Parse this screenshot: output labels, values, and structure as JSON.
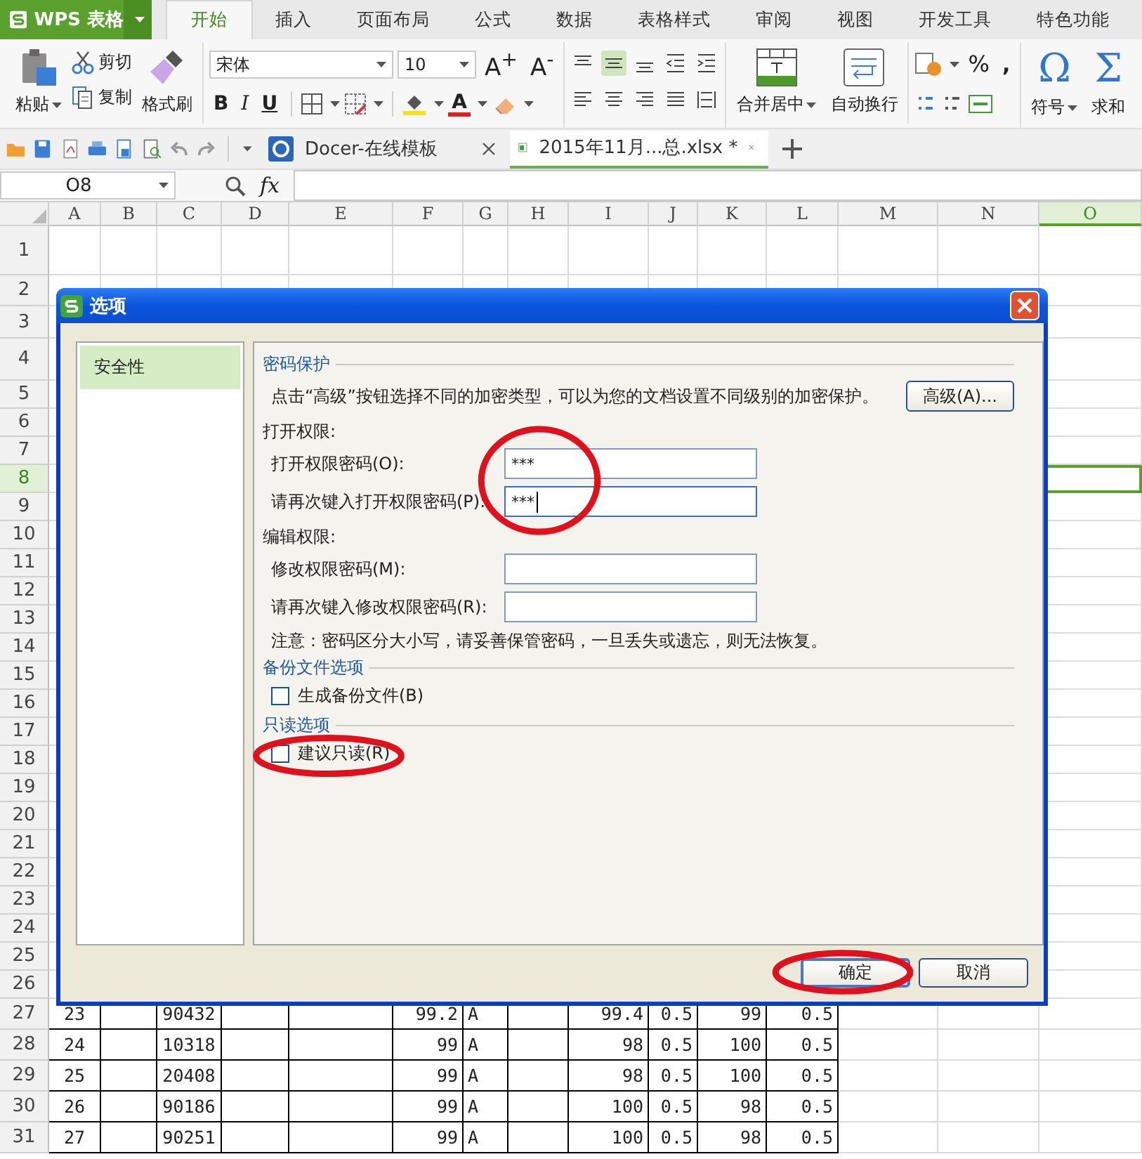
{
  "app_menu": {
    "label": "WPS 表格"
  },
  "ribbon_tabs": [
    {
      "label": "开始",
      "selected": true
    },
    {
      "label": "插入",
      "selected": false
    },
    {
      "label": "页面布局",
      "selected": false
    },
    {
      "label": "公式",
      "selected": false
    },
    {
      "label": "数据",
      "selected": false
    },
    {
      "label": "表格样式",
      "selected": false
    },
    {
      "label": "审阅",
      "selected": false
    },
    {
      "label": "视图",
      "selected": false
    },
    {
      "label": "开发工具",
      "selected": false
    },
    {
      "label": "特色功能",
      "selected": false
    }
  ],
  "ribbon": {
    "clipboard": {
      "paste": "粘贴",
      "cut": "剪切",
      "copy": "复制",
      "format_painter": "格式刷"
    },
    "font": {
      "name": "宋体",
      "size": "10",
      "grow": "A$^{+}$",
      "shrink": "A$^{-}$",
      "bold": "B",
      "italic": "I",
      "underline": "U",
      "font_color": "A"
    },
    "alignment": [
      {
        "kind": "top",
        "selected": false
      },
      {
        "kind": "middle",
        "selected": true
      },
      {
        "kind": "bottom",
        "selected": false
      },
      {
        "kind": "outdent",
        "selected": false
      },
      {
        "kind": "indent",
        "selected": false
      },
      {
        "kind": "left",
        "selected": false
      },
      {
        "kind": "center",
        "selected": false
      },
      {
        "kind": "right",
        "selected": false
      },
      {
        "kind": "justify",
        "selected": false
      },
      {
        "kind": "distributed",
        "selected": false
      }
    ],
    "merge": "合并居中",
    "wrap": "自动换行",
    "number": {
      "percent": "%",
      "comma": ","
    },
    "symbol": {
      "glyph": "Ω",
      "label": "符号"
    },
    "sum": {
      "glyph": "Σ",
      "label": "求和"
    }
  },
  "doc_tabs": [
    {
      "kind": "docer",
      "label": "Docer-在线模板",
      "selected": false
    },
    {
      "kind": "sheet",
      "label": "2015年11月...总.xlsx *",
      "selected": true
    }
  ],
  "formula_bar": {
    "cell": "O8",
    "fx": "fx"
  },
  "sheet": {
    "columns": [
      {
        "label": "A",
        "selected": false
      },
      {
        "label": "B",
        "selected": false
      },
      {
        "label": "C",
        "selected": false
      },
      {
        "label": "D",
        "selected": false
      },
      {
        "label": "E",
        "selected": false
      },
      {
        "label": "F",
        "selected": false
      },
      {
        "label": "G",
        "selected": false
      },
      {
        "label": "H",
        "selected": false
      },
      {
        "label": "I",
        "selected": false
      },
      {
        "label": "J",
        "selected": false
      },
      {
        "label": "K",
        "selected": false
      },
      {
        "label": "L",
        "selected": false
      },
      {
        "label": "M",
        "selected": false
      },
      {
        "label": "N",
        "selected": false
      },
      {
        "label": "O",
        "selected": true
      }
    ],
    "rows": [
      {
        "label": "1",
        "selected": false
      },
      {
        "label": "2",
        "selected": false
      },
      {
        "label": "3",
        "selected": false
      },
      {
        "label": "4",
        "selected": false
      },
      {
        "label": "5",
        "selected": false
      },
      {
        "label": "6",
        "selected": false
      },
      {
        "label": "7",
        "selected": false
      },
      {
        "label": "8",
        "selected": true
      },
      {
        "label": "9",
        "selected": false
      },
      {
        "label": "10",
        "selected": false
      },
      {
        "label": "11",
        "selected": false
      },
      {
        "label": "12",
        "selected": false
      },
      {
        "label": "13",
        "selected": false
      },
      {
        "label": "14",
        "selected": false
      },
      {
        "label": "15",
        "selected": false
      },
      {
        "label": "16",
        "selected": false
      },
      {
        "label": "17",
        "selected": false
      },
      {
        "label": "18",
        "selected": false
      },
      {
        "label": "19",
        "selected": false
      },
      {
        "label": "20",
        "selected": false
      },
      {
        "label": "21",
        "selected": false
      },
      {
        "label": "22",
        "selected": false
      },
      {
        "label": "23",
        "selected": false
      },
      {
        "label": "24",
        "selected": false
      },
      {
        "label": "25",
        "selected": false
      },
      {
        "label": "26",
        "selected": false
      },
      {
        "label": "27",
        "selected": false,
        "cells": [
          "23",
          null,
          "90432",
          null,
          null,
          "99.2",
          "A",
          null,
          "99.4",
          "0.5",
          "99",
          "0.5"
        ]
      },
      {
        "label": "28",
        "selected": false,
        "cells": [
          "24",
          null,
          "10318",
          null,
          null,
          "99",
          "A",
          null,
          "98",
          "0.5",
          "100",
          "0.5"
        ]
      },
      {
        "label": "29",
        "selected": false,
        "cells": [
          "25",
          null,
          "20408",
          null,
          null,
          "99",
          "A",
          null,
          "98",
          "0.5",
          "100",
          "0.5"
        ]
      },
      {
        "label": "30",
        "selected": false,
        "cells": [
          "26",
          null,
          "90186",
          null,
          null,
          "99",
          "A",
          null,
          "100",
          "0.5",
          "98",
          "0.5"
        ]
      },
      {
        "label": "31",
        "selected": false,
        "cells": [
          "27",
          null,
          "90251",
          null,
          null,
          "99",
          "A",
          null,
          "100",
          "0.5",
          "98",
          "0.5"
        ]
      }
    ]
  },
  "dialog": {
    "title": "选项",
    "nav": [
      {
        "label": "安全性",
        "selected": true
      }
    ],
    "sections": [
      {
        "title": "密码保护",
        "items": [
          {
            "kind": "note",
            "text": "点击“高级”按钮选择不同的加密类型，可以为您的文档设置不同级别的加密保护。",
            "button": "高级(A)..."
          },
          {
            "kind": "group",
            "title": "打开权限:",
            "circled": true,
            "fields": [
              {
                "label": "打开权限密码(O):",
                "value": "***",
                "focused": false
              },
              {
                "label": "请再次键入打开权限密码(P):",
                "value": "***",
                "focused": true
              }
            ]
          },
          {
            "kind": "group",
            "title": "编辑权限:",
            "circled": false,
            "fields": [
              {
                "label": "修改权限密码(M):",
                "focused": false
              },
              {
                "label": "请再次键入修改权限密码(R):",
                "focused": false
              }
            ]
          },
          {
            "kind": "note",
            "text": "注意：密码区分大小写，请妥善保管密码，一旦丢失或遗忘，则无法恢复。"
          }
        ]
      },
      {
        "title": "备份文件选项",
        "items": [
          {
            "kind": "checkbox",
            "label": "生成备份文件(B)",
            "checked": false,
            "circled": false
          }
        ]
      },
      {
        "title": "只读选项",
        "items": [
          {
            "kind": "checkbox",
            "label": "建议只读(R)",
            "checked": false,
            "circled": true
          }
        ]
      }
    ],
    "buttons": [
      {
        "label": "确定",
        "default": true,
        "circled": true
      },
      {
        "label": "取消",
        "default": false,
        "circled": false
      }
    ]
  }
}
